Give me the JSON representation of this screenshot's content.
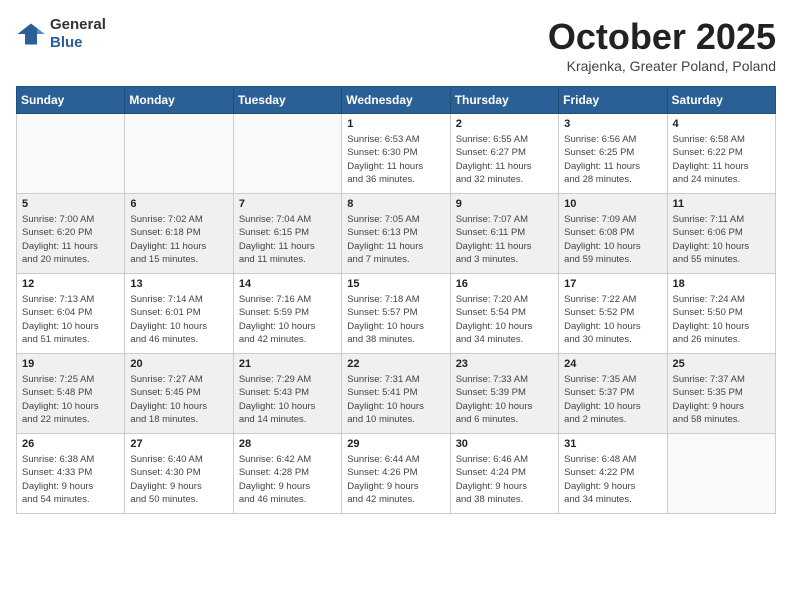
{
  "header": {
    "logo_general": "General",
    "logo_blue": "Blue",
    "month": "October 2025",
    "location": "Krajenka, Greater Poland, Poland"
  },
  "weekdays": [
    "Sunday",
    "Monday",
    "Tuesday",
    "Wednesday",
    "Thursday",
    "Friday",
    "Saturday"
  ],
  "weeks": [
    [
      {
        "day": "",
        "info": ""
      },
      {
        "day": "",
        "info": ""
      },
      {
        "day": "",
        "info": ""
      },
      {
        "day": "1",
        "info": "Sunrise: 6:53 AM\nSunset: 6:30 PM\nDaylight: 11 hours\nand 36 minutes."
      },
      {
        "day": "2",
        "info": "Sunrise: 6:55 AM\nSunset: 6:27 PM\nDaylight: 11 hours\nand 32 minutes."
      },
      {
        "day": "3",
        "info": "Sunrise: 6:56 AM\nSunset: 6:25 PM\nDaylight: 11 hours\nand 28 minutes."
      },
      {
        "day": "4",
        "info": "Sunrise: 6:58 AM\nSunset: 6:22 PM\nDaylight: 11 hours\nand 24 minutes."
      }
    ],
    [
      {
        "day": "5",
        "info": "Sunrise: 7:00 AM\nSunset: 6:20 PM\nDaylight: 11 hours\nand 20 minutes."
      },
      {
        "day": "6",
        "info": "Sunrise: 7:02 AM\nSunset: 6:18 PM\nDaylight: 11 hours\nand 15 minutes."
      },
      {
        "day": "7",
        "info": "Sunrise: 7:04 AM\nSunset: 6:15 PM\nDaylight: 11 hours\nand 11 minutes."
      },
      {
        "day": "8",
        "info": "Sunrise: 7:05 AM\nSunset: 6:13 PM\nDaylight: 11 hours\nand 7 minutes."
      },
      {
        "day": "9",
        "info": "Sunrise: 7:07 AM\nSunset: 6:11 PM\nDaylight: 11 hours\nand 3 minutes."
      },
      {
        "day": "10",
        "info": "Sunrise: 7:09 AM\nSunset: 6:08 PM\nDaylight: 10 hours\nand 59 minutes."
      },
      {
        "day": "11",
        "info": "Sunrise: 7:11 AM\nSunset: 6:06 PM\nDaylight: 10 hours\nand 55 minutes."
      }
    ],
    [
      {
        "day": "12",
        "info": "Sunrise: 7:13 AM\nSunset: 6:04 PM\nDaylight: 10 hours\nand 51 minutes."
      },
      {
        "day": "13",
        "info": "Sunrise: 7:14 AM\nSunset: 6:01 PM\nDaylight: 10 hours\nand 46 minutes."
      },
      {
        "day": "14",
        "info": "Sunrise: 7:16 AM\nSunset: 5:59 PM\nDaylight: 10 hours\nand 42 minutes."
      },
      {
        "day": "15",
        "info": "Sunrise: 7:18 AM\nSunset: 5:57 PM\nDaylight: 10 hours\nand 38 minutes."
      },
      {
        "day": "16",
        "info": "Sunrise: 7:20 AM\nSunset: 5:54 PM\nDaylight: 10 hours\nand 34 minutes."
      },
      {
        "day": "17",
        "info": "Sunrise: 7:22 AM\nSunset: 5:52 PM\nDaylight: 10 hours\nand 30 minutes."
      },
      {
        "day": "18",
        "info": "Sunrise: 7:24 AM\nSunset: 5:50 PM\nDaylight: 10 hours\nand 26 minutes."
      }
    ],
    [
      {
        "day": "19",
        "info": "Sunrise: 7:25 AM\nSunset: 5:48 PM\nDaylight: 10 hours\nand 22 minutes."
      },
      {
        "day": "20",
        "info": "Sunrise: 7:27 AM\nSunset: 5:45 PM\nDaylight: 10 hours\nand 18 minutes."
      },
      {
        "day": "21",
        "info": "Sunrise: 7:29 AM\nSunset: 5:43 PM\nDaylight: 10 hours\nand 14 minutes."
      },
      {
        "day": "22",
        "info": "Sunrise: 7:31 AM\nSunset: 5:41 PM\nDaylight: 10 hours\nand 10 minutes."
      },
      {
        "day": "23",
        "info": "Sunrise: 7:33 AM\nSunset: 5:39 PM\nDaylight: 10 hours\nand 6 minutes."
      },
      {
        "day": "24",
        "info": "Sunrise: 7:35 AM\nSunset: 5:37 PM\nDaylight: 10 hours\nand 2 minutes."
      },
      {
        "day": "25",
        "info": "Sunrise: 7:37 AM\nSunset: 5:35 PM\nDaylight: 9 hours\nand 58 minutes."
      }
    ],
    [
      {
        "day": "26",
        "info": "Sunrise: 6:38 AM\nSunset: 4:33 PM\nDaylight: 9 hours\nand 54 minutes."
      },
      {
        "day": "27",
        "info": "Sunrise: 6:40 AM\nSunset: 4:30 PM\nDaylight: 9 hours\nand 50 minutes."
      },
      {
        "day": "28",
        "info": "Sunrise: 6:42 AM\nSunset: 4:28 PM\nDaylight: 9 hours\nand 46 minutes."
      },
      {
        "day": "29",
        "info": "Sunrise: 6:44 AM\nSunset: 4:26 PM\nDaylight: 9 hours\nand 42 minutes."
      },
      {
        "day": "30",
        "info": "Sunrise: 6:46 AM\nSunset: 4:24 PM\nDaylight: 9 hours\nand 38 minutes."
      },
      {
        "day": "31",
        "info": "Sunrise: 6:48 AM\nSunset: 4:22 PM\nDaylight: 9 hours\nand 34 minutes."
      },
      {
        "day": "",
        "info": ""
      }
    ]
  ]
}
